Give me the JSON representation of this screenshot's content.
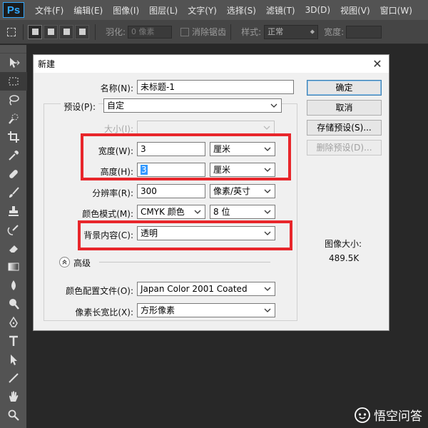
{
  "app": {
    "logo": "Ps",
    "menu": [
      "文件(F)",
      "编辑(E)",
      "图像(I)",
      "图层(L)",
      "文字(Y)",
      "选择(S)",
      "滤镜(T)",
      "3D(D)",
      "视图(V)",
      "窗口(W)"
    ]
  },
  "options_bar": {
    "feather_label": "羽化:",
    "feather_value": "0 像素",
    "antialias_label": "消除锯齿",
    "style_label": "样式:",
    "style_value": "正常",
    "width_label": "宽度:"
  },
  "dialog": {
    "title": "新建",
    "close": "✕",
    "name_label": "名称(N):",
    "name_value": "未标题-1",
    "preset_label": "预设(P):",
    "preset_value": "自定",
    "size_label": "大小(I):",
    "width_label": "宽度(W):",
    "width_value": "3",
    "width_unit": "厘米",
    "height_label": "高度(H):",
    "height_value": "3",
    "height_unit": "厘米",
    "resolution_label": "分辨率(R):",
    "resolution_value": "300",
    "resolution_unit": "像素/英寸",
    "color_mode_label": "颜色模式(M):",
    "color_mode_value": "CMYK 颜色",
    "bit_depth_value": "8 位",
    "background_label": "背景内容(C):",
    "background_value": "透明",
    "advanced_label": "高级",
    "color_profile_label": "颜色配置文件(O):",
    "color_profile_value": "Japan Color 2001 Coated",
    "pixel_aspect_label": "像素长宽比(X):",
    "pixel_aspect_value": "方形像素",
    "ok_button": "确定",
    "cancel_button": "取消",
    "save_preset_button": "存储预设(S)...",
    "delete_preset_button": "删除预设(D)...",
    "image_size_label": "图像大小:",
    "image_size_value": "489.5K"
  },
  "watermark": {
    "text": "悟空问答"
  },
  "colors": {
    "highlight_red": "#e8262b",
    "ps_blue": "#31a8ff",
    "selection_blue": "#3399ff"
  }
}
